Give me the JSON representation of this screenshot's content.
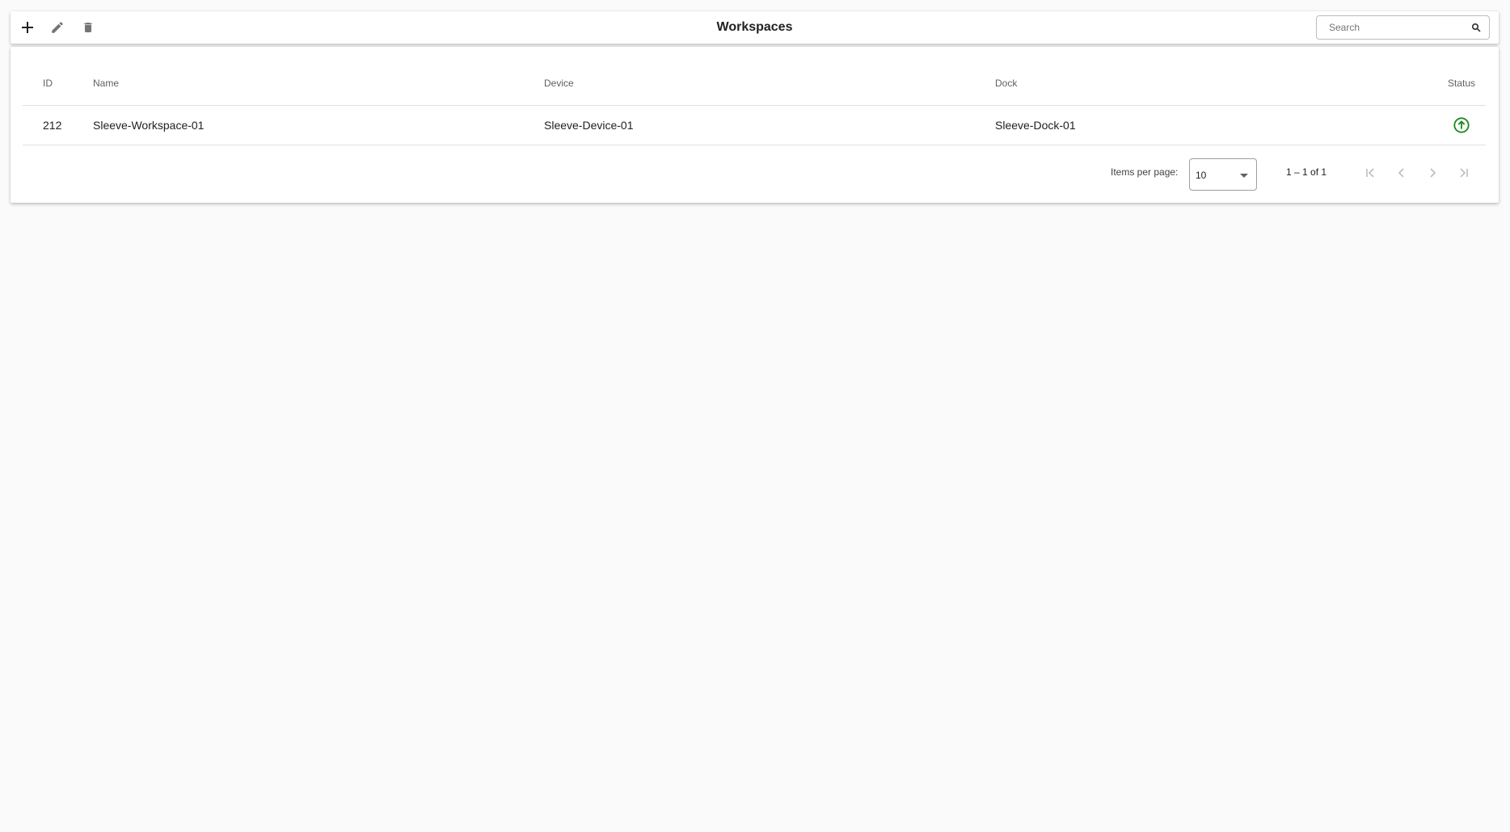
{
  "toolbar": {
    "title": "Workspaces",
    "search_placeholder": "Search",
    "search_value": ""
  },
  "table": {
    "columns": {
      "id": "ID",
      "name": "Name",
      "device": "Device",
      "dock": "Dock",
      "status": "Status"
    },
    "rows": [
      {
        "id": "212",
        "name": "Sleeve-Workspace-01",
        "device": "Sleeve-Device-01",
        "dock": "Sleeve-Dock-01",
        "status_icon": "arrow-up-circle-icon"
      }
    ]
  },
  "paginator": {
    "items_per_page_label": "Items per page:",
    "items_per_page_value": "10",
    "range_label": "1 – 1 of 1"
  },
  "colors": {
    "status_ok": "#1b8a1b",
    "icon_active": "#212121",
    "icon_muted": "#757575",
    "icon_disabled": "#bdbdbd"
  }
}
